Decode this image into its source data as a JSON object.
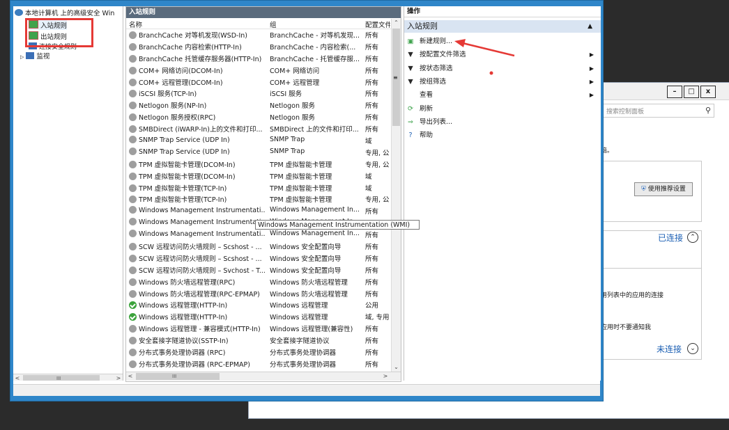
{
  "control_panel": {
    "window_controls": {
      "minimize": "–",
      "maximize": "□",
      "close": "x"
    },
    "search_placeholder": "搜索控制面板",
    "text_1": "电脑。",
    "recommend_button": "使用推荐设置",
    "connected_label": "已连接",
    "text_2": "应用列表中的应用的连接",
    "text_3": "新应用时不要通知我",
    "not_connected_label": "未连接"
  },
  "tree": {
    "root": "本地计算机 上的高级安全 Win",
    "items": [
      "入站规则",
      "出站规则",
      "连接安全规则",
      "监视"
    ]
  },
  "rules_pane": {
    "title": "入站规则",
    "columns": [
      "名称",
      "组",
      "配置文件"
    ],
    "rows": [
      {
        "name": "BranchCache 对等机发现(WSD-In)",
        "group": "BranchCache - 对等机发现...",
        "profile": "所有",
        "enabled": false
      },
      {
        "name": "BranchCache 内容检索(HTTP-In)",
        "group": "BranchCache - 内容检索(...",
        "profile": "所有",
        "enabled": false
      },
      {
        "name": "BranchCache 托管缓存服务器(HTTP-In)",
        "group": "BranchCache - 托管缓存服...",
        "profile": "所有",
        "enabled": false
      },
      {
        "name": "COM+ 网络访问(DCOM-In)",
        "group": "COM+ 网络访问",
        "profile": "所有",
        "enabled": false
      },
      {
        "name": "COM+ 远程管理(DCOM-In)",
        "group": "COM+ 远程管理",
        "profile": "所有",
        "enabled": false
      },
      {
        "name": "iSCSI 服务(TCP-In)",
        "group": "iSCSI 服务",
        "profile": "所有",
        "enabled": false
      },
      {
        "name": "Netlogon 服务(NP-In)",
        "group": "Netlogon 服务",
        "profile": "所有",
        "enabled": false
      },
      {
        "name": "Netlogon 服务授权(RPC)",
        "group": "Netlogon 服务",
        "profile": "所有",
        "enabled": false
      },
      {
        "name": "SMBDirect (iWARP-In)上的文件和打印...",
        "group": "SMBDirect 上的文件和打印...",
        "profile": "所有",
        "enabled": false
      },
      {
        "name": "SNMP Trap Service (UDP In)",
        "group": "SNMP Trap",
        "profile": "域",
        "enabled": false
      },
      {
        "name": "SNMP Trap Service (UDP In)",
        "group": "SNMP Trap",
        "profile": "专用, 公",
        "enabled": false
      },
      {
        "name": "TPM 虚拟智能卡管理(DCOM-In)",
        "group": "TPM 虚拟智能卡管理",
        "profile": "专用, 公",
        "enabled": false
      },
      {
        "name": "TPM 虚拟智能卡管理(DCOM-In)",
        "group": "TPM 虚拟智能卡管理",
        "profile": "域",
        "enabled": false
      },
      {
        "name": "TPM 虚拟智能卡管理(TCP-In)",
        "group": "TPM 虚拟智能卡管理",
        "profile": "域",
        "enabled": false
      },
      {
        "name": "TPM 虚拟智能卡管理(TCP-In)",
        "group": "TPM 虚拟智能卡管理",
        "profile": "专用, 公",
        "enabled": false
      },
      {
        "name": "Windows Management Instrumentati...",
        "group": "Windows Management In...",
        "profile": "所有",
        "enabled": false
      },
      {
        "name": "Windows Management Instrumentati...",
        "group": "Windows Management In...",
        "profile": "",
        "enabled": false
      },
      {
        "name": "Windows Management Instrumentati...",
        "group": "Windows Management In...",
        "profile": "所有",
        "enabled": false
      },
      {
        "name": "SCW 远程访问防火墙规则 – Scshost - ...",
        "group": "Windows 安全配置向导",
        "profile": "所有",
        "enabled": false
      },
      {
        "name": "SCW 远程访问防火墙规则 – Scshost - ...",
        "group": "Windows 安全配置向导",
        "profile": "所有",
        "enabled": false
      },
      {
        "name": "SCW 远程访问防火墙规则 – Svchost - T...",
        "group": "Windows 安全配置向导",
        "profile": "所有",
        "enabled": false
      },
      {
        "name": "Windows 防火墙远程管理(RPC)",
        "group": "Windows 防火墙远程管理",
        "profile": "所有",
        "enabled": false
      },
      {
        "name": "Windows 防火墙远程管理(RPC-EPMAP)",
        "group": "Windows 防火墙远程管理",
        "profile": "所有",
        "enabled": false
      },
      {
        "name": "Windows 远程管理(HTTP-In)",
        "group": "Windows 远程管理",
        "profile": "公用",
        "enabled": true
      },
      {
        "name": "Windows 远程管理(HTTP-In)",
        "group": "Windows 远程管理",
        "profile": "域, 专用",
        "enabled": true
      },
      {
        "name": "Windows 远程管理 - 兼容模式(HTTP-In)",
        "group": "Windows 远程管理(兼容性)",
        "profile": "所有",
        "enabled": false
      },
      {
        "name": "安全套接字隧道协议(SSTP-In)",
        "group": "安全套接字隧道协议",
        "profile": "所有",
        "enabled": false
      },
      {
        "name": "分布式事务处理协调器 (RPC)",
        "group": "分布式事务处理协调器",
        "profile": "所有",
        "enabled": false
      },
      {
        "name": "分布式事务处理协调器 (RPC-EPMAP)",
        "group": "分布式事务处理协调器",
        "profile": "所有",
        "enabled": false
      }
    ],
    "tooltip": "Windows Management Instrumentation (WMI)"
  },
  "actions": {
    "title": "操作",
    "section": "入站规则",
    "items": [
      {
        "label": "新建规则...",
        "icon": "new-rule-icon",
        "submenu": false
      },
      {
        "label": "按配置文件筛选",
        "icon": "filter-icon",
        "submenu": true
      },
      {
        "label": "按状态筛选",
        "icon": "filter-icon",
        "submenu": true
      },
      {
        "label": "按组筛选",
        "icon": "filter-icon",
        "submenu": true
      },
      {
        "label": "查看",
        "icon": "",
        "submenu": true
      },
      {
        "label": "刷新",
        "icon": "refresh-icon",
        "submenu": false
      },
      {
        "label": "导出列表...",
        "icon": "export-icon",
        "submenu": false
      },
      {
        "label": "帮助",
        "icon": "help-icon",
        "submenu": false
      }
    ]
  },
  "colors": {
    "highlight_box": "#e53935",
    "annotation_arrow": "#e53935",
    "title_bar": "#2f86c9"
  }
}
